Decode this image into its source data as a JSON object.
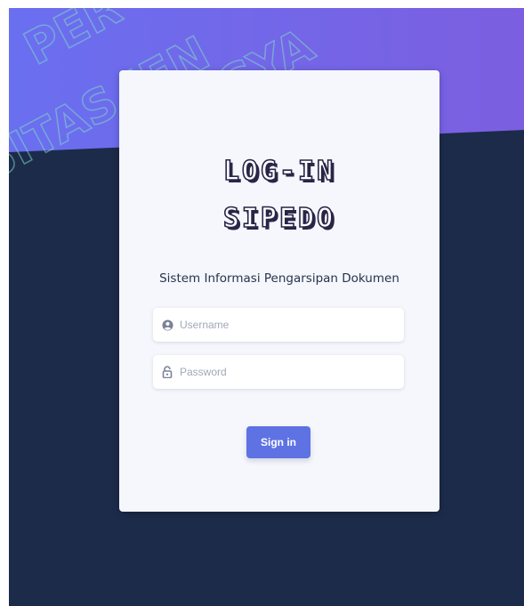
{
  "page": {
    "background_dark": "#1c2b4a",
    "background_gradient": [
      "#6a6ff0",
      "#7b5fe0"
    ],
    "accent": "#5e72e4"
  },
  "watermark": {
    "lines": [
      "PER",
      "SITAS JEN",
      "YOGYA"
    ]
  },
  "login_card": {
    "logo_line1": "LOG-IN",
    "logo_line2": "SIPEDO",
    "subtitle": "Sistem Informasi Pengarsipan Dokumen",
    "username": {
      "placeholder": "Username",
      "value": "",
      "icon": "user-circle-icon"
    },
    "password": {
      "placeholder": "Password",
      "value": "",
      "icon": "lock-icon"
    },
    "submit_label": "Sign in"
  }
}
